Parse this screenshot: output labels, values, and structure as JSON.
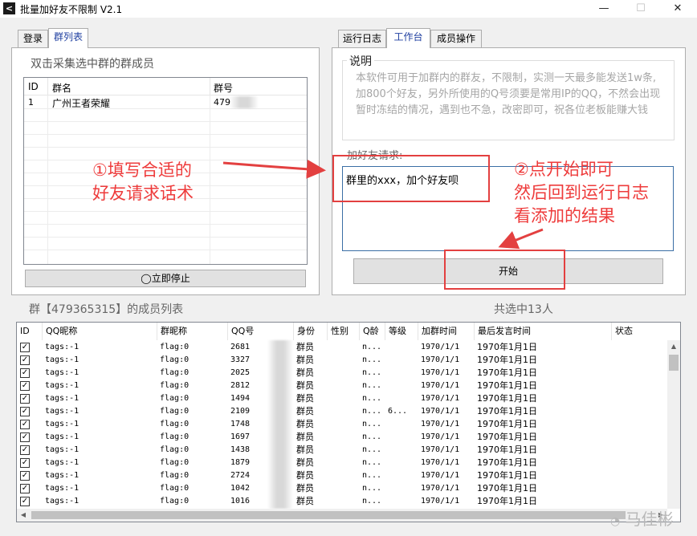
{
  "window": {
    "title": "批量加好友不限制 V2.1",
    "minimize": "—",
    "maximize": "☐",
    "close": "✕",
    "icon": "back-arrow-icon"
  },
  "left_tabs": [
    "登录",
    "群列表"
  ],
  "left_panel": {
    "caption": "双击采集选中群的群成员",
    "table": {
      "columns": [
        "ID",
        "群名",
        "群号"
      ],
      "rows": [
        {
          "id": "1",
          "name": "广州王者荣耀",
          "number": "479"
        }
      ]
    },
    "stop_button": "◯立即停止"
  },
  "right_tabs": [
    "运行日志",
    "工作台",
    "成员操作"
  ],
  "right_panel": {
    "notice_title": "说明",
    "notice_text": "本软件可用于加群内的群友，不限制，实测一天最多能发送1w条,加800个好友，另外所使用的Q号须要是常用IP的QQ，不然会出现暂时冻结的情况，遇到也不急，改密即可，祝各位老板能赚大钱",
    "request_label": "加好友请求:",
    "request_text": "群里的xxx，加个好友呗",
    "start_button": "开始"
  },
  "annotations": {
    "step1_line1": "①填写合适的",
    "step1_line2": "好友请求话术",
    "step2_line1": "②点开始即可",
    "step2_line2": "然后回到运行日志",
    "step2_line3": "看添加的结果"
  },
  "members": {
    "title": "群【479365315】的成员列表",
    "selected": "共选中13人",
    "columns": [
      "ID",
      "QQ昵称",
      "群昵称",
      "QQ号",
      "身份",
      "性别",
      "Q龄",
      "等级",
      "加群时间",
      "最后发言时间",
      "状态"
    ],
    "rows": [
      {
        "nick": "tags:-1",
        "gnick": "flag:0",
        "qq": "2681",
        "role": "群员",
        "qage": "n...",
        "level": "",
        "join": "1970/1/1",
        "last": "1970年1月1日"
      },
      {
        "nick": "tags:-1",
        "gnick": "flag:0",
        "qq": "3327",
        "role": "群员",
        "qage": "n...",
        "level": "",
        "join": "1970/1/1",
        "last": "1970年1月1日"
      },
      {
        "nick": "tags:-1",
        "gnick": "flag:0",
        "qq": "2025",
        "role": "群员",
        "qage": "n...",
        "level": "",
        "join": "1970/1/1",
        "last": "1970年1月1日"
      },
      {
        "nick": "tags:-1",
        "gnick": "flag:0",
        "qq": "2812",
        "role": "群员",
        "qage": "n...",
        "level": "",
        "join": "1970/1/1",
        "last": "1970年1月1日"
      },
      {
        "nick": "tags:-1",
        "gnick": "flag:0",
        "qq": "1494",
        "role": "群员",
        "qage": "n...",
        "level": "",
        "join": "1970/1/1",
        "last": "1970年1月1日"
      },
      {
        "nick": "tags:-1",
        "gnick": "flag:0",
        "qq": "2109",
        "role": "群员",
        "qage": "n...",
        "level": "6...",
        "join": "1970/1/1",
        "last": "1970年1月1日"
      },
      {
        "nick": "tags:-1",
        "gnick": "flag:0",
        "qq": "1748",
        "role": "群员",
        "qage": "n...",
        "level": "",
        "join": "1970/1/1",
        "last": "1970年1月1日"
      },
      {
        "nick": "tags:-1",
        "gnick": "flag:0",
        "qq": "1697",
        "role": "群员",
        "qage": "n...",
        "level": "",
        "join": "1970/1/1",
        "last": "1970年1月1日"
      },
      {
        "nick": "tags:-1",
        "gnick": "flag:0",
        "qq": "1438",
        "role": "群员",
        "qage": "n...",
        "level": "",
        "join": "1970/1/1",
        "last": "1970年1月1日"
      },
      {
        "nick": "tags:-1",
        "gnick": "flag:0",
        "qq": "1879",
        "role": "群员",
        "qage": "n...",
        "level": "",
        "join": "1970/1/1",
        "last": "1970年1月1日"
      },
      {
        "nick": "tags:-1",
        "gnick": "flag:0",
        "qq": "2724",
        "role": "群员",
        "qage": "n...",
        "level": "",
        "join": "1970/1/1",
        "last": "1970年1月1日"
      },
      {
        "nick": "tags:-1",
        "gnick": "flag:0",
        "qq": "1042",
        "role": "群员",
        "qage": "n...",
        "level": "",
        "join": "1970/1/1",
        "last": "1970年1月1日"
      },
      {
        "nick": "tags:-1",
        "gnick": "flag:0",
        "qq": "1016",
        "role": "群员",
        "qage": "n...",
        "level": "",
        "join": "1970/1/1",
        "last": "1970年1月1日"
      }
    ]
  },
  "watermark": "马佳彬",
  "colors": {
    "annotation": "#ee3b3b",
    "tab_active_text": "#1f3fa0",
    "request_border": "#3a6ea5"
  }
}
